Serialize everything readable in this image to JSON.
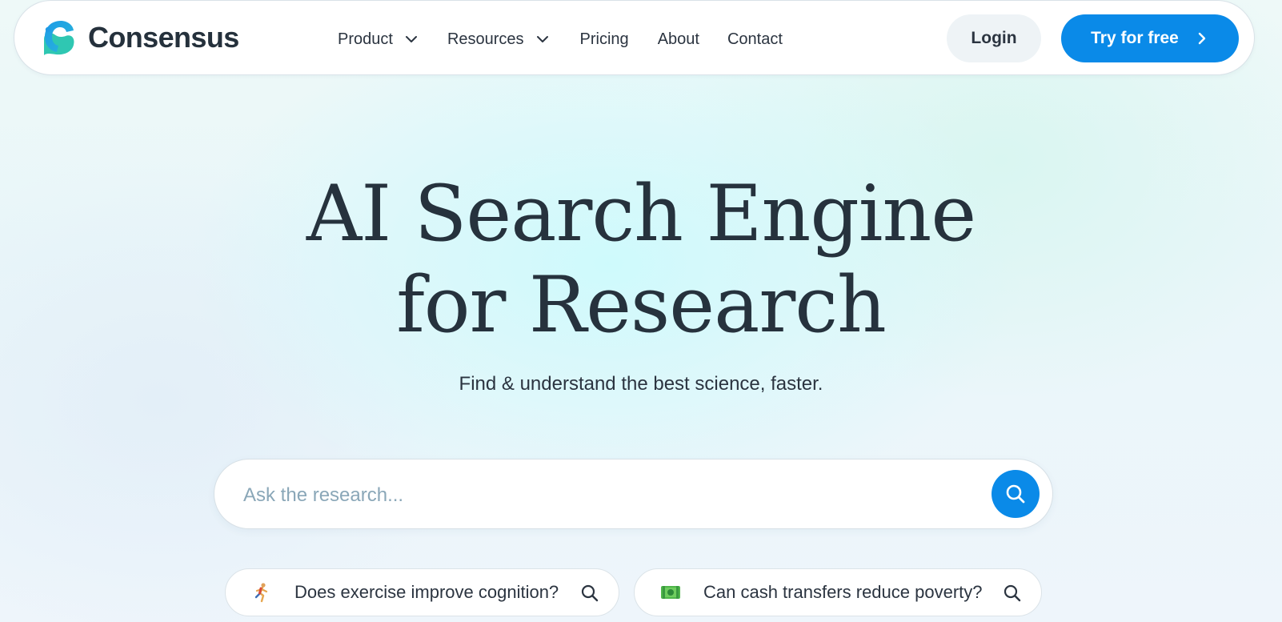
{
  "header": {
    "brand": "Consensus",
    "nav": [
      {
        "label": "Product",
        "has_dropdown": true
      },
      {
        "label": "Resources",
        "has_dropdown": true
      },
      {
        "label": "Pricing",
        "has_dropdown": false
      },
      {
        "label": "About",
        "has_dropdown": false
      },
      {
        "label": "Contact",
        "has_dropdown": false
      }
    ],
    "login_label": "Login",
    "cta_label": "Try for free"
  },
  "hero": {
    "title_line1": "AI Search Engine",
    "title_line2": "for Research",
    "subtitle": "Find & understand the best science, faster."
  },
  "search": {
    "placeholder": "Ask the research...",
    "value": ""
  },
  "suggestions": [
    {
      "icon": "running-person-emoji",
      "text": "Does exercise improve cognition?"
    },
    {
      "icon": "money-emoji",
      "text": "Can cash transfers reduce poverty?"
    }
  ],
  "colors": {
    "accent": "#0a8ae8",
    "text": "#2b3440",
    "brand_teal": "#2fc7b2",
    "brand_blue": "#1f9ae6",
    "placeholder": "#8aa7b8"
  }
}
